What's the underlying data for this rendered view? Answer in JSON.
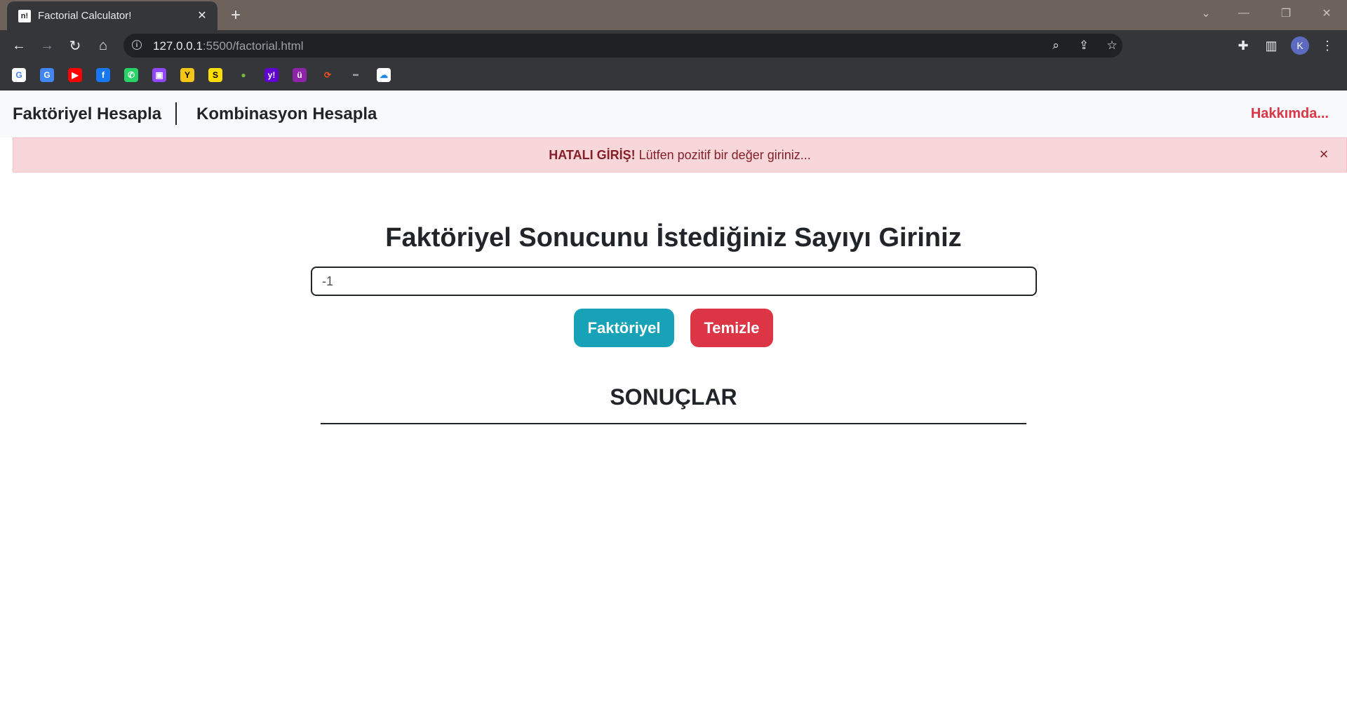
{
  "browser": {
    "tab_title": "Factorial Calculator!",
    "tab_favicon_text": "n!",
    "url_host": "127.0.0.1",
    "url_rest": ":5500/factorial.html",
    "avatar_letter": "K",
    "bookmarks": [
      {
        "name": "google-bookmark-icon",
        "glyph": "G",
        "color": "#ffffff",
        "text_color": "#4285f4"
      },
      {
        "name": "google-translate-bookmark-icon",
        "glyph": "G",
        "color": "#4285f4",
        "text_color": "#ffffff"
      },
      {
        "name": "youtube-bookmark-icon",
        "glyph": "▶",
        "color": "#ff0000",
        "text_color": "#ffffff"
      },
      {
        "name": "facebook-bookmark-icon",
        "glyph": "f",
        "color": "#1877f2",
        "text_color": "#ffffff"
      },
      {
        "name": "whatsapp-bookmark-icon",
        "glyph": "✆",
        "color": "#25d366",
        "text_color": "#ffffff"
      },
      {
        "name": "twitch-bookmark-icon",
        "glyph": "▣",
        "color": "#9146ff",
        "text_color": "#ffffff"
      },
      {
        "name": "yellow-bookmark-icon",
        "glyph": "Y",
        "color": "#f5c518",
        "text_color": "#000000"
      },
      {
        "name": "s-bookmark-icon",
        "glyph": "S",
        "color": "#ffdd00",
        "text_color": "#000000"
      },
      {
        "name": "drop-bookmark-icon",
        "glyph": "●",
        "color": "#35363a",
        "text_color": "#7cb342"
      },
      {
        "name": "yahoo-bookmark-icon",
        "glyph": "y!",
        "color": "#6001d2",
        "text_color": "#ffffff"
      },
      {
        "name": "u-bookmark-icon",
        "glyph": "ü",
        "color": "#8e24aa",
        "text_color": "#ffffff"
      },
      {
        "name": "orange-bookmark-icon",
        "glyph": "⟳",
        "color": "#35363a",
        "text_color": "#f4511e"
      },
      {
        "name": "dash-bookmark-icon",
        "glyph": "━",
        "color": "#35363a",
        "text_color": "#9aa0a6"
      },
      {
        "name": "cloud-bookmark-icon",
        "glyph": "☁",
        "color": "#ffffff",
        "text_color": "#1e88e5"
      }
    ]
  },
  "navbar": {
    "link_factorial": "Faktöriyel Hesapla",
    "link_combination": "Kombinasyon Hesapla",
    "about": "Hakkımda..."
  },
  "alert": {
    "strong": "HATALI GİRİŞ!",
    "message": " Lütfen pozitif bir değer giriniz..."
  },
  "main": {
    "heading": "Faktöriyel Sonucunu İstediğiniz Sayıyı Giriniz",
    "input_value": "-1",
    "calc_button": "Faktöriyel",
    "clear_button": "Temizle",
    "results_title": "SONUÇLAR"
  }
}
